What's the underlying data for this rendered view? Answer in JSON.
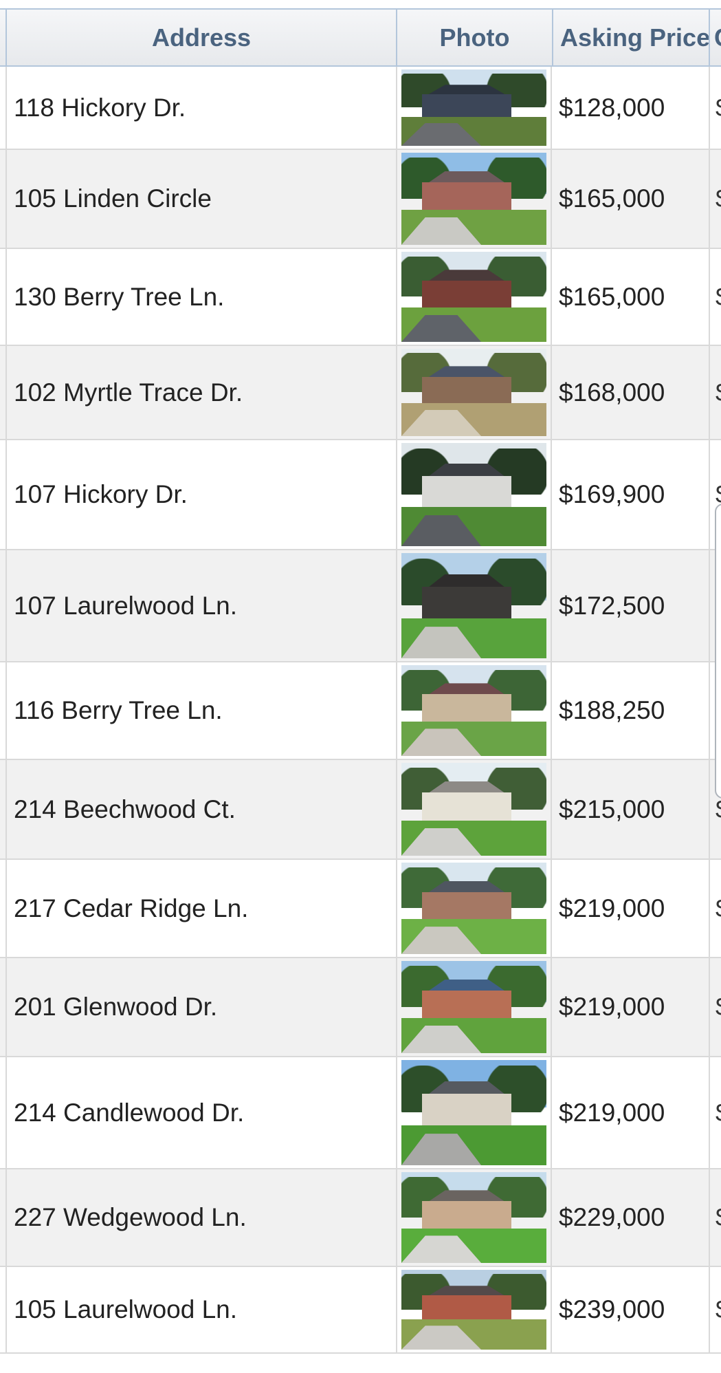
{
  "table": {
    "columns": [
      "Address",
      "Photo",
      "Asking Price",
      "C"
    ],
    "rows": [
      {
        "address": "118 Hickory Dr.",
        "price": "$128,000",
        "next": "$",
        "photo": {
          "sky": "#cfe0ee",
          "trees": "#2f4a2a",
          "house": "#3c4658",
          "roof": "#2c3440",
          "lawn": "#5f7e3a",
          "drive": "#6a6c70"
        }
      },
      {
        "address": "105 Linden Circle",
        "price": "$165,000",
        "next": "$",
        "photo": {
          "sky": "#8fbde6",
          "trees": "#2e5a2b",
          "house": "#a5655a",
          "roof": "#6d5a5c",
          "lawn": "#6fa143",
          "drive": "#c9c9c4"
        }
      },
      {
        "address": "130 Berry Tree Ln.",
        "price": "$165,000",
        "next": "$",
        "photo": {
          "sky": "#dbe6ee",
          "trees": "#3a5d33",
          "house": "#7a3e36",
          "roof": "#4a3a3a",
          "lawn": "#6ca13e",
          "drive": "#5f6369"
        }
      },
      {
        "address": "102 Myrtle Trace Dr.",
        "price": "$168,000",
        "next": "$",
        "photo": {
          "sky": "#e8eef0",
          "trees": "#566b3b",
          "house": "#8a6b55",
          "roof": "#4a5468",
          "lawn": "#b0a073",
          "drive": "#d3cbb8"
        }
      },
      {
        "address": "107 Hickory Dr.",
        "price": "$169,900",
        "next": "$",
        "photo": {
          "sky": "#dfe6ea",
          "trees": "#253a24",
          "house": "#d9d9d6",
          "roof": "#3b3e43",
          "lawn": "#4f8a34",
          "drive": "#5a5d62"
        }
      },
      {
        "address": "107 Laurelwood Ln.",
        "price": "$172,500",
        "next": "",
        "photo": {
          "sky": "#b4d0e8",
          "trees": "#2b4b2b",
          "house": "#3c3a38",
          "roof": "#2e2c2c",
          "lawn": "#58a33c",
          "drive": "#c4c4be"
        }
      },
      {
        "address": "116 Berry Tree Ln.",
        "price": "$188,250",
        "next": "",
        "photo": {
          "sky": "#d6e3ee",
          "trees": "#3d6536",
          "house": "#c9b79c",
          "roof": "#6e4a4c",
          "lawn": "#6aa447",
          "drive": "#c9c4bb"
        }
      },
      {
        "address": "214 Beechwood Ct.",
        "price": "$215,000",
        "next": "$",
        "photo": {
          "sky": "#e4edf2",
          "trees": "#405e36",
          "house": "#e6e2d6",
          "roof": "#8d8a86",
          "lawn": "#5da33b",
          "drive": "#cfcfcb"
        }
      },
      {
        "address": "217 Cedar Ridge Ln.",
        "price": "$219,000",
        "next": "$",
        "photo": {
          "sky": "#d9e6ef",
          "trees": "#3f6a38",
          "house": "#a57864",
          "roof": "#4f5660",
          "lawn": "#6db146",
          "drive": "#cac8c0"
        }
      },
      {
        "address": "201 Glenwood Dr.",
        "price": "$219,000",
        "next": "$",
        "photo": {
          "sky": "#9cc3e6",
          "trees": "#3b6a2f",
          "house": "#b86f55",
          "roof": "#3f5f86",
          "lawn": "#60a33d",
          "drive": "#cfcfcb"
        }
      },
      {
        "address": "214 Candlewood Dr.",
        "price": "$219,000",
        "next": "$",
        "photo": {
          "sky": "#7fb2e3",
          "trees": "#2d4f2a",
          "house": "#d9d2c5",
          "roof": "#565a60",
          "lawn": "#4c9a33",
          "drive": "#a8a8a6"
        }
      },
      {
        "address": "227 Wedgewood Ln.",
        "price": "$229,000",
        "next": "$",
        "photo": {
          "sky": "#c6dcec",
          "trees": "#3f6a34",
          "house": "#c9ab8e",
          "roof": "#6a6460",
          "lawn": "#59ad3c",
          "drive": "#d6d6d2"
        }
      },
      {
        "address": "105 Laurelwood Ln.",
        "price": "$239,000",
        "next": "$",
        "photo": {
          "sky": "#b9cfe2",
          "trees": "#3c5a2f",
          "house": "#b05a46",
          "roof": "#544a4a",
          "lawn": "#8aa14f",
          "drive": "#cbc9c4"
        }
      }
    ]
  }
}
